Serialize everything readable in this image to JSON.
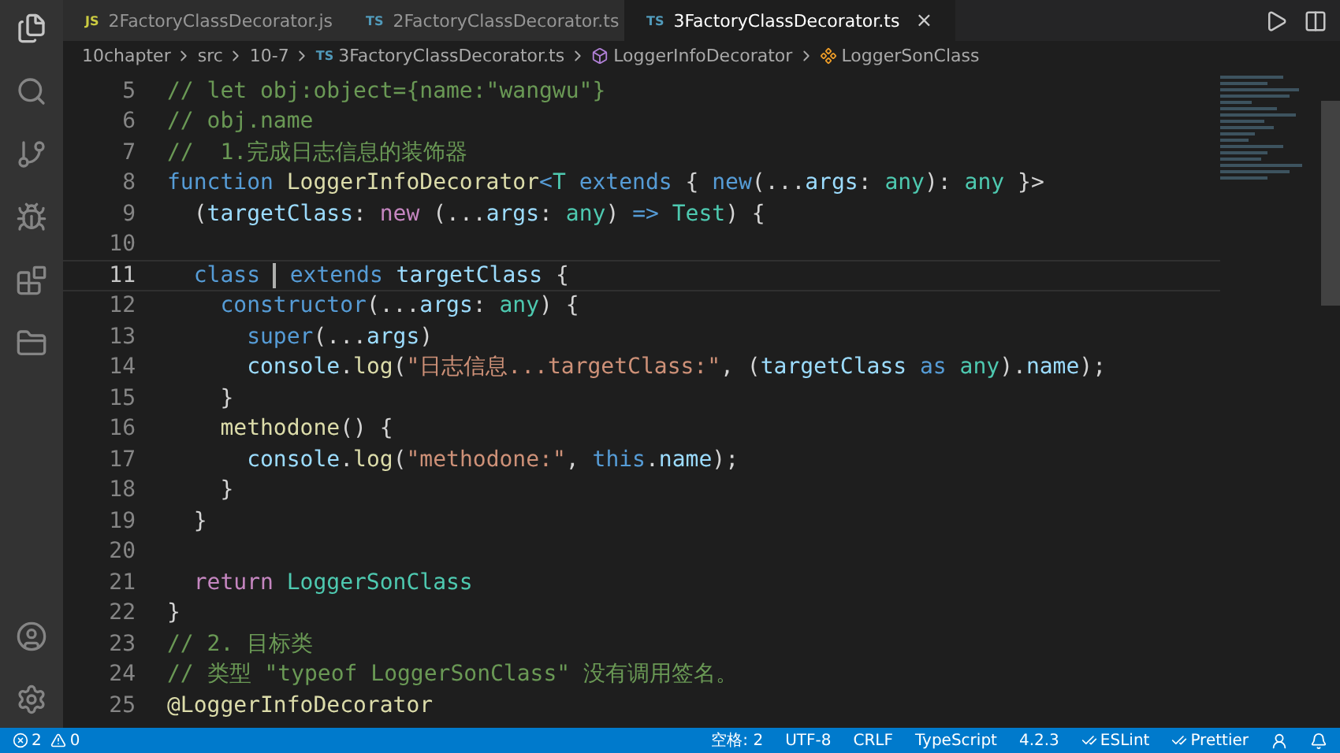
{
  "tabs": [
    {
      "badge": "JS",
      "kind": "js",
      "label": "2FactoryClassDecorator.js",
      "selected": false
    },
    {
      "badge": "TS",
      "kind": "ts",
      "label": "2FactoryClassDecorator.ts",
      "selected": false
    },
    {
      "badge": "TS",
      "kind": "ts",
      "label": "3FactoryClassDecorator.ts",
      "selected": true,
      "close": "×"
    }
  ],
  "breadcrumb": [
    {
      "kind": "folder",
      "label": "10chapter"
    },
    {
      "kind": "folder",
      "label": "src"
    },
    {
      "kind": "folder",
      "label": "10-7"
    },
    {
      "kind": "file",
      "badge": "TS",
      "label": "3FactoryClassDecorator.ts"
    },
    {
      "kind": "function",
      "label": "LoggerInfoDecorator"
    },
    {
      "kind": "class",
      "label": "LoggerSonClass"
    }
  ],
  "lines": [
    {
      "number": "5",
      "selected": false,
      "tokens": [
        {
          "kind": "comment",
          "text": "// let obj:object={name:\"wangwu\"}"
        }
      ]
    },
    {
      "number": "6",
      "selected": false,
      "tokens": [
        {
          "kind": "comment",
          "text": "// obj.name"
        }
      ]
    },
    {
      "number": "7",
      "selected": false,
      "tokens": [
        {
          "kind": "comment",
          "text": "//  1.完成日志信息的装饰器"
        }
      ]
    },
    {
      "number": "8",
      "selected": false,
      "tokens": [
        {
          "kind": "keyword",
          "text": "function "
        },
        {
          "kind": "func",
          "text": "LoggerInfoDecorator"
        },
        {
          "kind": "keyword",
          "text": "<"
        },
        {
          "kind": "type",
          "text": "T"
        },
        {
          "kind": "keyword",
          "text": " extends "
        },
        {
          "kind": "plain",
          "text": "{ "
        },
        {
          "kind": "keyword",
          "text": "new"
        },
        {
          "kind": "plain",
          "text": "(..."
        },
        {
          "kind": "var",
          "text": "args"
        },
        {
          "kind": "plain",
          "text": ": "
        },
        {
          "kind": "type",
          "text": "any"
        },
        {
          "kind": "plain",
          "text": "): "
        },
        {
          "kind": "type",
          "text": "any"
        },
        {
          "kind": "plain",
          "text": " }>"
        }
      ]
    },
    {
      "number": "9",
      "selected": false,
      "tokens": [
        {
          "kind": "plain",
          "text": "  ("
        },
        {
          "kind": "var",
          "text": "targetClass"
        },
        {
          "kind": "plain",
          "text": ": "
        },
        {
          "kind": "control",
          "text": "new"
        },
        {
          "kind": "plain",
          "text": " (..."
        },
        {
          "kind": "var",
          "text": "args"
        },
        {
          "kind": "plain",
          "text": ": "
        },
        {
          "kind": "type",
          "text": "any"
        },
        {
          "kind": "plain",
          "text": ") "
        },
        {
          "kind": "keyword",
          "text": "=>"
        },
        {
          "kind": "type",
          "text": " Test"
        },
        {
          "kind": "plain",
          "text": ") {"
        }
      ]
    },
    {
      "number": "10",
      "selected": false
    },
    {
      "number": "11",
      "selected": true,
      "tokens": [
        {
          "kind": "keyword",
          "text": "  class "
        },
        {
          "kind": "cursor"
        },
        {
          "kind": "keyword",
          "text": " extends "
        },
        {
          "kind": "var",
          "text": "targetClass"
        },
        {
          "kind": "plain",
          "text": " {"
        }
      ]
    },
    {
      "number": "12",
      "selected": false,
      "tokens": [
        {
          "kind": "keyword",
          "text": "    constructor"
        },
        {
          "kind": "plain",
          "text": "(..."
        },
        {
          "kind": "var",
          "text": "args"
        },
        {
          "kind": "plain",
          "text": ": "
        },
        {
          "kind": "type",
          "text": "any"
        },
        {
          "kind": "plain",
          "text": ") {"
        }
      ]
    },
    {
      "number": "13",
      "selected": false,
      "tokens": [
        {
          "kind": "keyword",
          "text": "      super"
        },
        {
          "kind": "plain",
          "text": "(..."
        },
        {
          "kind": "var",
          "text": "args"
        },
        {
          "kind": "plain",
          "text": ")"
        }
      ]
    },
    {
      "number": "14",
      "selected": false,
      "tokens": [
        {
          "kind": "var",
          "text": "      console"
        },
        {
          "kind": "plain",
          "text": "."
        },
        {
          "kind": "func",
          "text": "log"
        },
        {
          "kind": "plain",
          "text": "("
        },
        {
          "kind": "string",
          "text": "\"日志信息...targetClass:\""
        },
        {
          "kind": "plain",
          "text": ", ("
        },
        {
          "kind": "var",
          "text": "targetClass"
        },
        {
          "kind": "keyword",
          "text": " as "
        },
        {
          "kind": "type",
          "text": "any"
        },
        {
          "kind": "plain",
          "text": ")."
        },
        {
          "kind": "var",
          "text": "name"
        },
        {
          "kind": "plain",
          "text": ");"
        }
      ]
    },
    {
      "number": "15",
      "selected": false,
      "tokens": [
        {
          "kind": "plain",
          "text": "    }"
        }
      ]
    },
    {
      "number": "16",
      "selected": false,
      "tokens": [
        {
          "kind": "func",
          "text": "    methodone"
        },
        {
          "kind": "plain",
          "text": "() {"
        }
      ]
    },
    {
      "number": "17",
      "selected": false,
      "tokens": [
        {
          "kind": "var",
          "text": "      console"
        },
        {
          "kind": "plain",
          "text": "."
        },
        {
          "kind": "func",
          "text": "log"
        },
        {
          "kind": "plain",
          "text": "("
        },
        {
          "kind": "string",
          "text": "\"methodone:\""
        },
        {
          "kind": "plain",
          "text": ", "
        },
        {
          "kind": "keyword",
          "text": "this"
        },
        {
          "kind": "plain",
          "text": "."
        },
        {
          "kind": "var",
          "text": "name"
        },
        {
          "kind": "plain",
          "text": ");"
        }
      ]
    },
    {
      "number": "18",
      "selected": false,
      "tokens": [
        {
          "kind": "plain",
          "text": "    }"
        }
      ]
    },
    {
      "number": "19",
      "selected": false,
      "tokens": [
        {
          "kind": "plain",
          "text": "  }"
        }
      ]
    },
    {
      "number": "20",
      "selected": false
    },
    {
      "number": "21",
      "selected": false,
      "tokens": [
        {
          "kind": "control",
          "text": "  return "
        },
        {
          "kind": "type",
          "text": "LoggerSonClass"
        }
      ]
    },
    {
      "number": "22",
      "selected": false,
      "tokens": [
        {
          "kind": "plain",
          "text": "}"
        }
      ]
    },
    {
      "number": "23",
      "selected": false,
      "tokens": [
        {
          "kind": "comment",
          "text": "// 2. 目标类"
        }
      ]
    },
    {
      "number": "24",
      "selected": false,
      "tokens": [
        {
          "kind": "comment",
          "text": "// 类型 \"typeof LoggerSonClass\" 没有调用签名。"
        }
      ]
    },
    {
      "number": "25",
      "selected": false,
      "tokens": [
        {
          "kind": "func",
          "text": "@LoggerInfoDecorator"
        }
      ]
    }
  ],
  "status_bar": {
    "errors": "2",
    "warnings": "0",
    "items": [
      "空格: 2",
      "UTF-8",
      "CRLF",
      "TypeScript",
      "4.2.3"
    ],
    "linters": [
      "ESLint",
      "Prettier"
    ]
  }
}
